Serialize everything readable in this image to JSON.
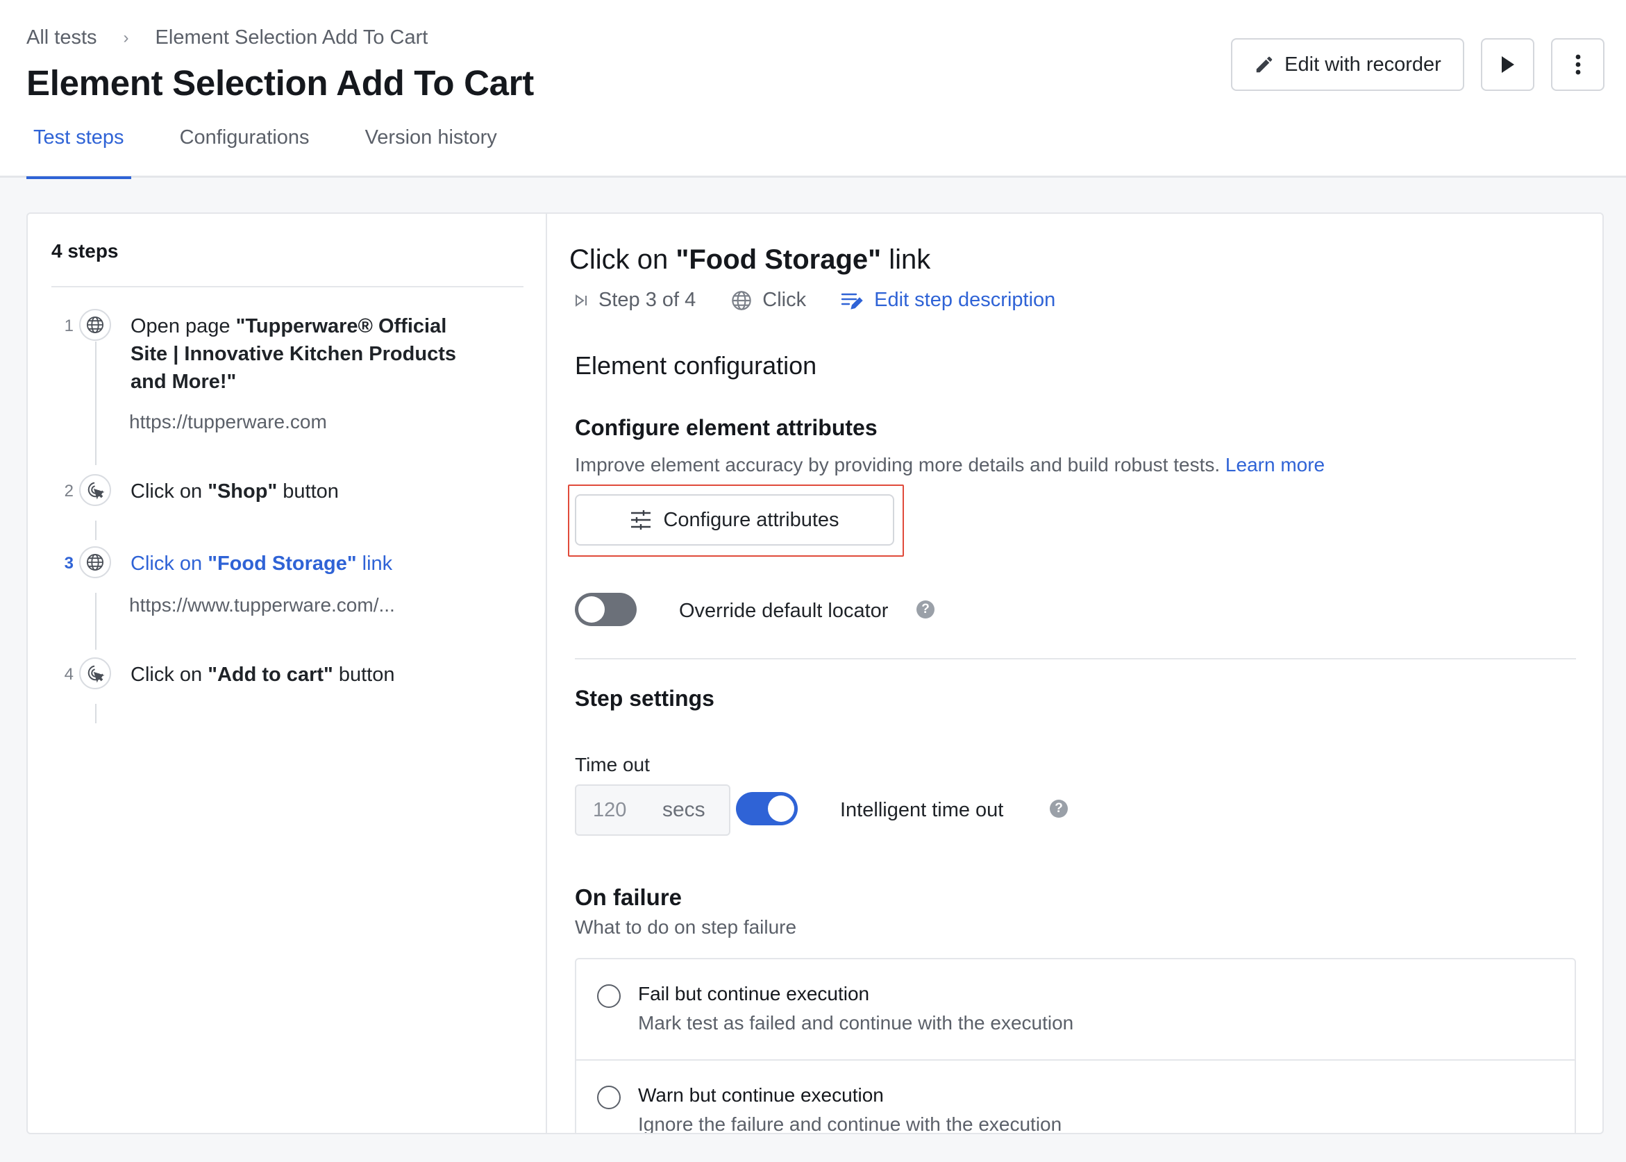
{
  "breadcrumb": {
    "root": "All tests",
    "separator": "›",
    "current": "Element Selection Add To Cart"
  },
  "title": "Element Selection Add To Cart",
  "tabs": [
    {
      "label": "Test steps",
      "active": true
    },
    {
      "label": "Configurations",
      "active": false
    },
    {
      "label": "Version history",
      "active": false
    }
  ],
  "header_actions": {
    "edit_label": "Edit with recorder"
  },
  "steps_panel": {
    "count_label": "4 steps",
    "steps": [
      {
        "number": "1",
        "icon": "globe-icon",
        "prefix": "Open page ",
        "target_line1": "\"Tupperware® Official",
        "target_line2": "Site | Innovative Kitchen Products",
        "target_line3": "and More!\"",
        "suffix": "",
        "url": "https://tupperware.com"
      },
      {
        "number": "2",
        "icon": "click-cursor-icon",
        "prefix": "Click on ",
        "target": "\"Shop\"",
        "suffix": " button"
      },
      {
        "number": "3",
        "icon": "globe-icon",
        "prefix": "Click on ",
        "target": "\"Food Storage\"",
        "suffix": " link",
        "url": "https://www.tupperware.com/...",
        "active": true
      },
      {
        "number": "4",
        "icon": "click-cursor-icon",
        "prefix": "Click on ",
        "target": "\"Add to cart\"",
        "suffix": " button"
      }
    ]
  },
  "detail": {
    "title_prefix": "Click on ",
    "title_target": "\"Food Storage\"",
    "title_suffix": " link",
    "step_position": "Step 3 of 4",
    "action_type": "Click",
    "edit_description_label": "Edit step description",
    "element_config_heading": "Element configuration",
    "configure_attrs_heading": "Configure element attributes",
    "configure_attrs_desc": "Improve element accuracy by providing more details and build robust tests.",
    "learn_more": "Learn more",
    "configure_attrs_button": "Configure attributes",
    "override_locator_label": "Override default locator",
    "override_locator_on": false,
    "step_settings_heading": "Step settings",
    "timeout_label": "Time out",
    "timeout_value": "120",
    "timeout_unit": "secs",
    "intelligent_timeout_label": "Intelligent time out",
    "intelligent_timeout_on": true,
    "on_failure_heading": "On failure",
    "on_failure_desc": "What to do on step failure",
    "failure_options": [
      {
        "title": "Fail but continue execution",
        "desc": "Mark test as failed and continue with the execution"
      },
      {
        "title": "Warn but continue execution",
        "desc": "Ignore the failure and continue with the execution"
      }
    ]
  },
  "colors": {
    "accent": "#2f63d6",
    "highlight": "#e04a3a",
    "toggle_off": "#6b7079"
  }
}
